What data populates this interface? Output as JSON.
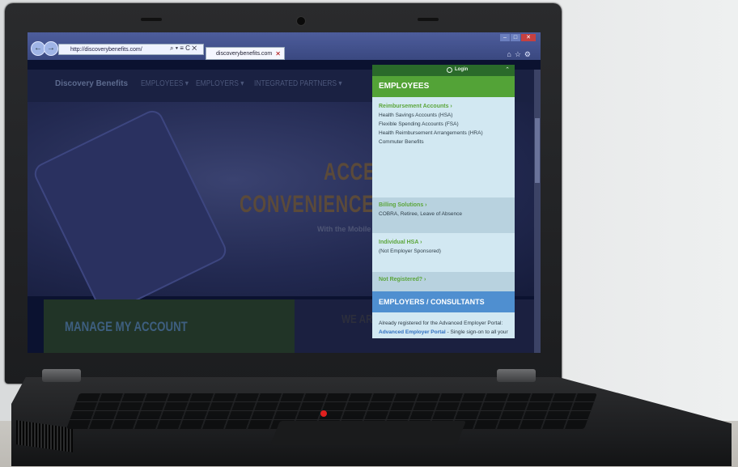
{
  "browser": {
    "address": "http://discoverybenefits.com/",
    "address_controls": "⌕ ▾ ≡ C ✕",
    "tab_title": "discoverybenefits.com",
    "tab_close": "✕"
  },
  "site": {
    "logo": "Discovery Benefits",
    "nav": [
      "EMPLOYEES ▾",
      "EMPLOYERS ▾",
      "INTEGRATED PARTNERS ▾"
    ],
    "hero_line1": "ACCES",
    "hero_line2": "CONVENIENCE A",
    "hero_sub": "With the Mobile",
    "manage_title": "MANAGE MY ACCOUNT",
    "we_are": "WE AR"
  },
  "panel": {
    "login": "Login",
    "employees_header": "EMPLOYEES",
    "sections": [
      {
        "title": "Reimbursement Accounts ›",
        "items": [
          "Health Savings Accounts (HSA)",
          "Flexible Spending Accounts (FSA)",
          "Health Reimbursement Arrangements (HRA)",
          "Commuter Benefits"
        ]
      },
      {
        "title": "Billing Solutions ›",
        "items": [
          "COBRA, Retiree, Leave of Absence"
        ]
      },
      {
        "title": "Individual HSA ›",
        "items": [
          "(Not Employer Sponsored)"
        ]
      },
      {
        "title": "Not Registered? ›",
        "items": []
      }
    ],
    "consultants_header": "EMPLOYERS / CONSULTANTS",
    "consultants_text": "Already registered for the Advanced Employer Portal:",
    "consultants_link": "Advanced Employer Portal",
    "consultants_tail": " - Single sign-on to all your administration sites"
  },
  "colors": {
    "green_header": "#53a337",
    "blue_header": "#4f8fd0",
    "trackpoint": "#e0201e"
  }
}
